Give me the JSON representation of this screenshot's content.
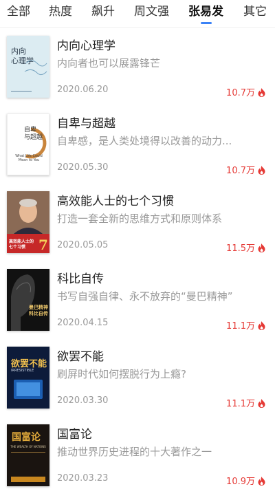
{
  "tabs": [
    {
      "label": "全部",
      "active": false
    },
    {
      "label": "热度",
      "active": false
    },
    {
      "label": "飙升",
      "active": false
    },
    {
      "label": "周文强",
      "active": false
    },
    {
      "label": "张易发",
      "active": true
    },
    {
      "label": "其它",
      "active": false
    }
  ],
  "accent_color": "#3b82f6",
  "hot_color": "#e53935",
  "books": [
    {
      "title": "内向心理学",
      "subtitle": "内向者也可以展露锋芒",
      "date": "2020.06.20",
      "hot": "10.7万",
      "cover_text": "内向\n心理学"
    },
    {
      "title": "自卑与超越",
      "subtitle": "自卑感，是人类处境得以改善的动力...",
      "date": "2020.05.30",
      "hot": "10.7万",
      "cover_text": "自卑\n与超越",
      "cover_subtext": "What Life Could Mean to You"
    },
    {
      "title": "高效能人士的七个习惯",
      "subtitle": "打造一套全新的思维方式和原则体系",
      "date": "2020.05.05",
      "hot": "11.5万",
      "cover_text": "高效能人士的\n七个习惯",
      "cover_big": "7"
    },
    {
      "title": "科比自传",
      "subtitle": "书写自强自律、永不放弃的“曼巴精神”",
      "date": "2020.04.15",
      "hot": "11.1万",
      "cover_text": "曼巴精神\n科比自传"
    },
    {
      "title": "欲罢不能",
      "subtitle": "刷屏时代如何摆脱行为上瘾?",
      "date": "2020.03.30",
      "hot": "11.1万",
      "cover_text": "欲罢不能",
      "cover_subtext": "IRRESISTIBLE"
    },
    {
      "title": "国富论",
      "subtitle": "推动世界历史进程的十大著作之一",
      "date": "2020.03.23",
      "hot": "10.9万",
      "cover_text": "国富论",
      "cover_subtext": "THE WEALTH OF NATIONS"
    }
  ]
}
